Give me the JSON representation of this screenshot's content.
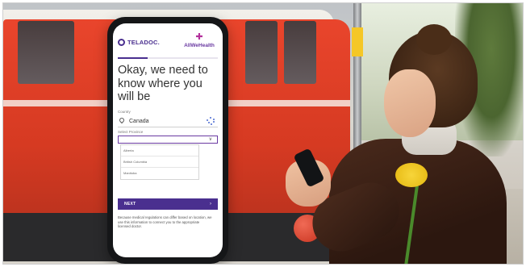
{
  "colors": {
    "brand_purple": "#4a2f8f",
    "brand_pink": "#b4319c"
  },
  "app": {
    "logo_text": "TELADOC.",
    "partner_logo_text": "AllWeHealth",
    "progress": 0.3
  },
  "form": {
    "heading": "Okay, we need to know where you will be",
    "country_label": "Country",
    "country_value": "Canada",
    "province_label": "Select Province",
    "province_options": [
      "Alberta",
      "British Columbia",
      "Manitoba"
    ],
    "next_label": "NEXT",
    "note": "Because medical regulations can differ based on location, we use this information to connect you to the appropriate licensed doctor."
  }
}
